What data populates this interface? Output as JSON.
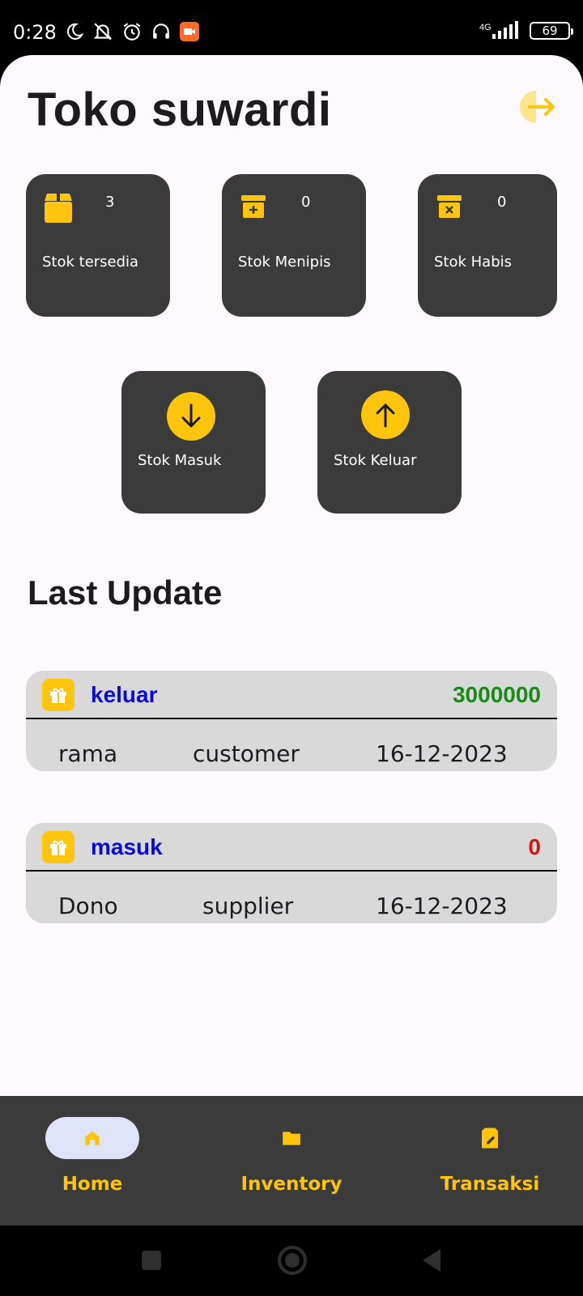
{
  "status_bar": {
    "time": "0:28",
    "network": "4G",
    "battery": "69"
  },
  "header": {
    "title": "Toko suwardi"
  },
  "stock_cards": [
    {
      "label": "Stok tersedia",
      "count": "3"
    },
    {
      "label": "Stok Menipis",
      "count": "0"
    },
    {
      "label": "Stok Habis",
      "count": "0"
    }
  ],
  "action_cards": [
    {
      "label": "Stok Masuk"
    },
    {
      "label": "Stok Keluar"
    }
  ],
  "last_update": {
    "title": "Last Update",
    "items": [
      {
        "type": "keluar",
        "amount": "3000000",
        "amount_color": "#1a8a1a",
        "name": "rama",
        "role": "customer",
        "date": "16-12-2023"
      },
      {
        "type": "masuk",
        "amount": "0",
        "amount_color": "#cc1a1a",
        "name": "Dono",
        "role": "supplier",
        "date": "16-12-2023"
      }
    ]
  },
  "bottom_nav": {
    "items": [
      {
        "label": "Home",
        "icon": "home-icon",
        "active": true
      },
      {
        "label": "Inventory",
        "icon": "folder-icon",
        "active": false
      },
      {
        "label": "Transaksi",
        "icon": "receipt-edit-icon",
        "active": false
      }
    ]
  },
  "colors": {
    "accent": "#ffc40c",
    "card_bg": "#3b3b3b",
    "type_text": "#0a0ad8"
  }
}
